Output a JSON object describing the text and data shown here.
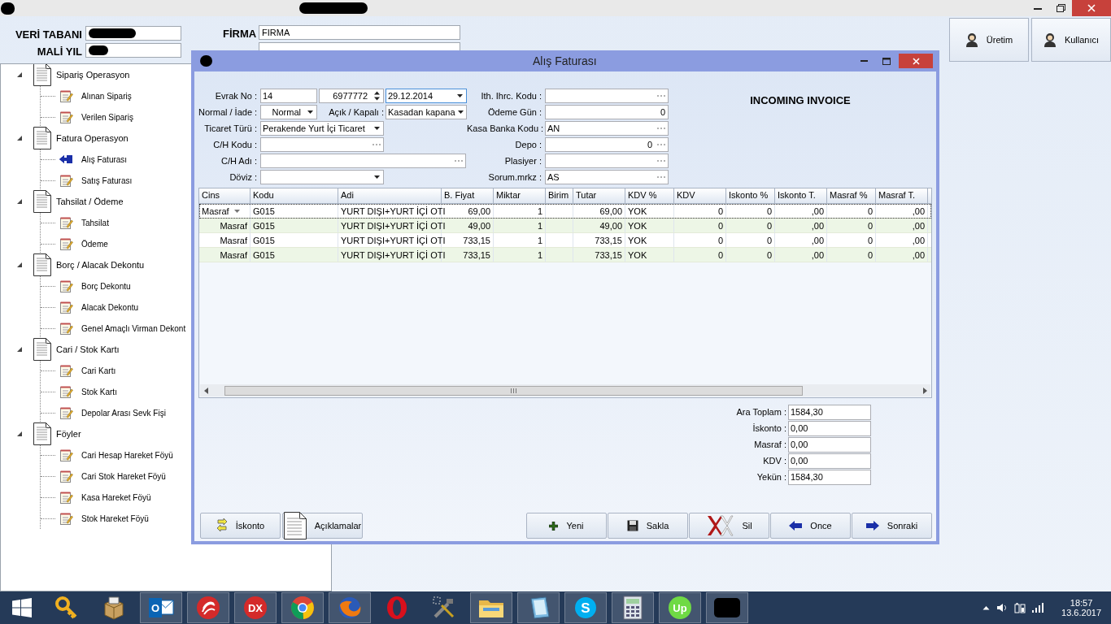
{
  "header": {
    "fields": [
      {
        "label": "VERİ TABANI"
      },
      {
        "label": "MALİ YIL"
      }
    ],
    "company": [
      {
        "label": "FİRMA",
        "value": "FIRMA"
      }
    ],
    "buttons": [
      {
        "label": "Üretim"
      },
      {
        "label": "Kullanıcı"
      }
    ]
  },
  "tree": [
    {
      "label": "Sipariş Operasyon",
      "expanded": true,
      "children": [
        {
          "label": "Alınan Sipariş",
          "selected": false
        },
        {
          "label": "Verilen Sipariş",
          "selected": false
        }
      ]
    },
    {
      "label": "Fatura Operasyon",
      "expanded": true,
      "children": [
        {
          "label": "Alış Faturası",
          "selected": true
        },
        {
          "label": "Satış Faturası",
          "selected": false
        }
      ]
    },
    {
      "label": "Tahsilat / Ödeme",
      "expanded": true,
      "children": [
        {
          "label": "Tahsilat",
          "selected": false
        },
        {
          "label": "Ödeme",
          "selected": false
        }
      ]
    },
    {
      "label": "Borç / Alacak Dekontu",
      "expanded": true,
      "children": [
        {
          "label": "Borç Dekontu",
          "selected": false
        },
        {
          "label": "Alacak Dekontu",
          "selected": false
        },
        {
          "label": "Genel Amaçlı Virman Dekont",
          "selected": false
        }
      ]
    },
    {
      "label": "Cari / Stok Kartı",
      "expanded": true,
      "children": [
        {
          "label": "Cari Kartı",
          "selected": false
        },
        {
          "label": "Stok Kartı",
          "selected": false
        },
        {
          "label": "Depolar Arası Sevk Fişi",
          "selected": false
        }
      ]
    },
    {
      "label": "Föyler",
      "expanded": true,
      "children": [
        {
          "label": "Cari Hesap Hareket Föyü",
          "selected": false
        },
        {
          "label": "Cari Stok Hareket Föyü",
          "selected": false
        },
        {
          "label": "Kasa Hareket Föyü",
          "selected": false
        },
        {
          "label": "Stok Hareket Föyü",
          "selected": false
        }
      ]
    }
  ],
  "dialog": {
    "title": "Alış Faturası",
    "heading": "INCOMING INVOICE",
    "form_left": [
      {
        "label": "Evrak No :",
        "items": [
          {
            "kind": "text",
            "value": "14"
          },
          {
            "kind": "spin",
            "value": "6977772"
          },
          {
            "kind": "combo",
            "value": "29.12.2014"
          }
        ]
      },
      {
        "label": "Normal / İade :",
        "items": [
          {
            "kind": "combo",
            "value": "Normal"
          },
          {
            "kind": "label",
            "text": "Açık / Kapalı :"
          },
          {
            "kind": "combo",
            "value": "Kasadan kapana"
          }
        ]
      },
      {
        "label": "Ticaret Türü :",
        "items": [
          {
            "kind": "combo",
            "value": "Perakende Yurt İçi Ticaret"
          }
        ]
      },
      {
        "label": "C/H Kodu :",
        "items": [
          {
            "kind": "lookup"
          }
        ]
      },
      {
        "label": "C/H Adı :",
        "items": [
          {
            "kind": "lookup"
          }
        ]
      },
      {
        "label": "Döviz :",
        "items": [
          {
            "kind": "combo"
          }
        ]
      }
    ],
    "form_right": [
      {
        "label": "Ith. Ihrc. Kodu :",
        "kind": "lookup"
      },
      {
        "label": "Ödeme Gün :",
        "kind": "number",
        "value": "0"
      },
      {
        "label": "Kasa Banka Kodu :",
        "kind": "lookup",
        "value": "AN"
      },
      {
        "label": "Depo :",
        "kind": "lookup_number",
        "value": "0"
      },
      {
        "label": "Plasiyer :",
        "kind": "lookup"
      },
      {
        "label": "Sorum.mrkz :",
        "kind": "lookup",
        "value": "AS"
      }
    ],
    "table": {
      "columns": [
        "Cins",
        "Kodu",
        "Adi",
        "B. Fiyat",
        "Miktar",
        "Birim",
        "Tutar",
        "KDV %",
        "KDV",
        "Iskonto %",
        "Iskonto T.",
        "Masraf %",
        "Masraf T."
      ],
      "rows": [
        {
          "selected": true,
          "cells": [
            "Masraf",
            "G015",
            "YURT DIŞI+YURT İÇİ OTI",
            "69,00",
            "1",
            null,
            "69,00",
            "YOK",
            "0",
            "0",
            ",00",
            "0",
            ",00"
          ]
        },
        {
          "selected": false,
          "cells": [
            "Masraf",
            "G015",
            "YURT DIŞI+YURT İÇİ OTI",
            "49,00",
            "1",
            null,
            "49,00",
            "YOK",
            "0",
            "0",
            ",00",
            "0",
            ",00"
          ]
        },
        {
          "selected": false,
          "cells": [
            "Masraf",
            "G015",
            "YURT DIŞI+YURT İÇİ OTI",
            "733,15",
            "1",
            null,
            "733,15",
            "YOK",
            "0",
            "0",
            ",00",
            "0",
            ",00"
          ]
        },
        {
          "selected": false,
          "cells": [
            "Masraf",
            "G015",
            "YURT DIŞI+YURT İÇİ OTI",
            "733,15",
            "1",
            null,
            "733,15",
            "YOK",
            "0",
            "0",
            ",00",
            "0",
            ",00"
          ]
        }
      ]
    },
    "totals": [
      {
        "label": "Ara Toplam :",
        "value": "1584,30"
      },
      {
        "label": "İskonto :",
        "value": "0,00"
      },
      {
        "label": "Masraf :",
        "value": "0,00"
      },
      {
        "label": "KDV :",
        "value": "0,00"
      },
      {
        "label": "Yekün :",
        "value": "1584,30"
      }
    ],
    "buttons_left": [
      {
        "kind": "discount",
        "label": "İskonto"
      },
      {
        "kind": "notes",
        "label": "Açıklamalar"
      }
    ],
    "buttons_right": [
      {
        "kind": "new",
        "label": "Yeni"
      },
      {
        "kind": "save",
        "label": "Sakla"
      },
      {
        "kind": "delete",
        "label": "Sil"
      },
      {
        "kind": "prev",
        "label": "Once"
      },
      {
        "kind": "next",
        "label": "Sonraki"
      }
    ]
  },
  "taskbar": {
    "items": [
      {
        "kind": "keys",
        "running": false
      },
      {
        "kind": "package",
        "running": false
      },
      {
        "kind": "mail",
        "glyph": "O",
        "running": true
      },
      {
        "kind": "swirl",
        "running": true
      },
      {
        "kind": "circle",
        "glyph": "DX",
        "running": true
      },
      {
        "kind": "globe",
        "running": true
      },
      {
        "kind": "fox",
        "running": true
      },
      {
        "kind": "ring",
        "running": false
      },
      {
        "kind": "tools",
        "running": false
      },
      {
        "kind": "folder",
        "running": true
      },
      {
        "kind": "notepad",
        "running": true
      },
      {
        "kind": "circle_blue",
        "glyph": "S",
        "running": true
      },
      {
        "kind": "calculator",
        "running": true
      },
      {
        "kind": "circle_green",
        "glyph": "Up",
        "running": true
      },
      {
        "kind": "redacted",
        "running": true
      }
    ],
    "time": "18:57",
    "date": "13.6.2017"
  }
}
